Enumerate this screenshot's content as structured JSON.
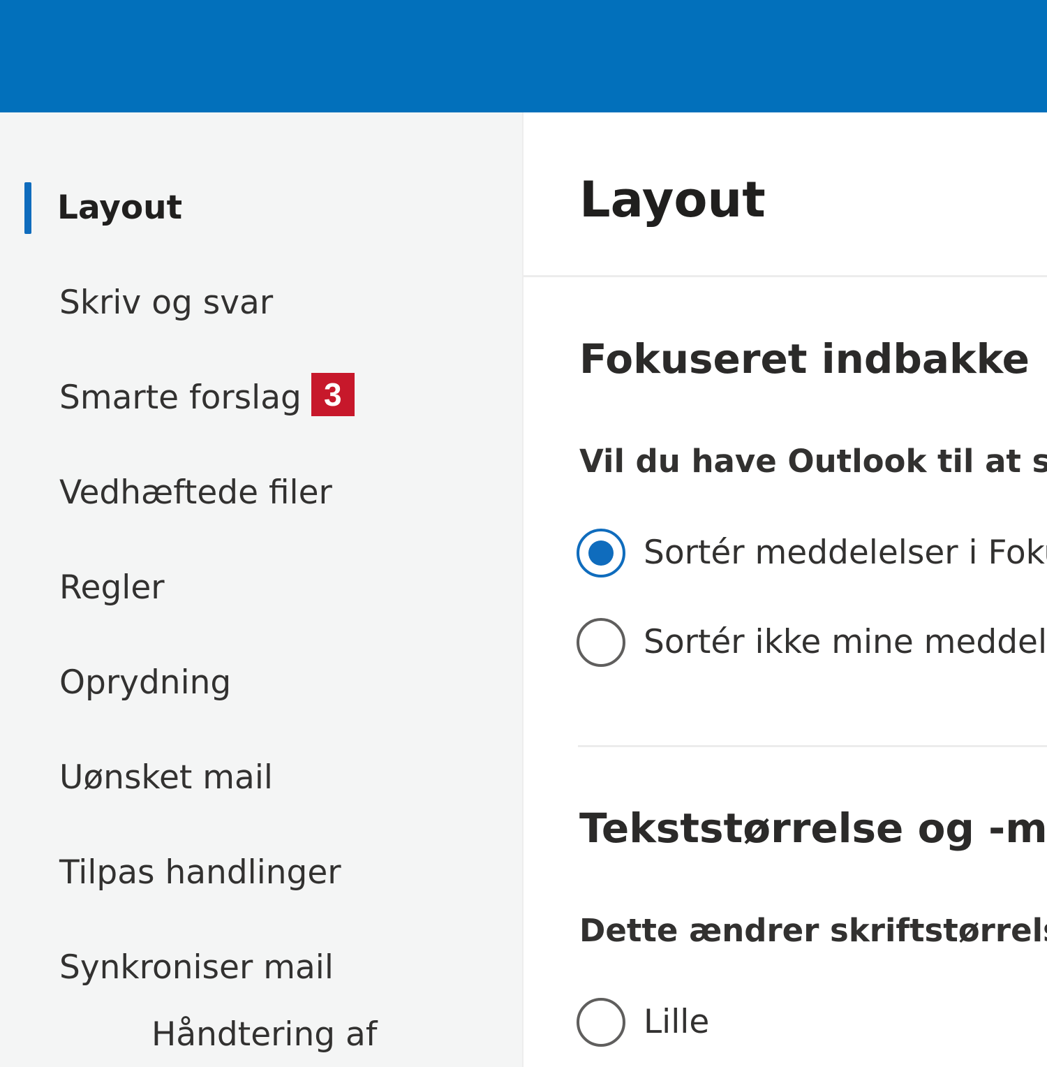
{
  "sidebar": {
    "items": [
      {
        "label": "Layout",
        "selected": true
      },
      {
        "label": "Skriv og svar"
      },
      {
        "label": "Smarte forslag",
        "badge": "3"
      },
      {
        "label": "Vedhæftede filer"
      },
      {
        "label": "Regler"
      },
      {
        "label": "Oprydning"
      },
      {
        "label": "Uønsket mail"
      },
      {
        "label": "Tilpas handlinger"
      },
      {
        "label": "Synkroniser mail"
      },
      {
        "label": "Håndtering af"
      }
    ]
  },
  "main": {
    "title": "Layout",
    "focused_inbox": {
      "title": "Fokuseret indbakke",
      "question": "Vil du have Outlook til at sor",
      "options": [
        {
          "label": "Sortér meddelelser i Foku",
          "checked": true
        },
        {
          "label": "Sortér ikke mine meddele",
          "checked": false
        }
      ]
    },
    "text_size": {
      "title": "Tekststørrelse og -melle",
      "description": "Dette ændrer skriftstørrelser",
      "options": [
        {
          "label": "Lille",
          "checked": false
        }
      ]
    }
  },
  "colors": {
    "topbar": "#0270bb",
    "accent": "#0f6cbd",
    "badge": "#c7182b",
    "sidebar_bg": "#f4f5f5"
  }
}
